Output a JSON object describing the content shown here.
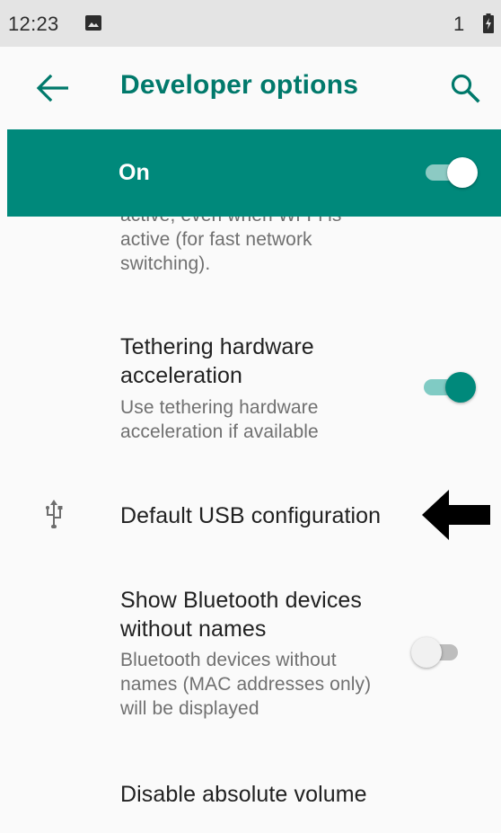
{
  "status_bar": {
    "time": "12:23",
    "sim_indicator": "1",
    "icons": [
      "image-icon",
      "battery-icon"
    ]
  },
  "app_bar": {
    "title": "Developer options",
    "back_icon": "arrow-back-icon",
    "search_icon": "search-icon"
  },
  "master_switch": {
    "label": "On",
    "checked": true
  },
  "settings": {
    "partial_item": {
      "summary": "active, even when Wi-Fi is active (for fast network switching)."
    },
    "tethering": {
      "title": "Tethering hardware acceleration",
      "summary": "Use tethering hardware acceleration if available",
      "checked": true
    },
    "usb": {
      "title": "Default USB configuration",
      "icon": "usb-icon"
    },
    "bluetooth": {
      "title": "Show Bluetooth devices without names",
      "summary": "Bluetooth devices without names (MAC addresses only) will be displayed",
      "checked": false
    },
    "absolute_volume": {
      "title": "Disable absolute volume"
    }
  },
  "colors": {
    "accent": "#00796b",
    "bar": "#00897b",
    "status_bar": "#e4e4e4",
    "background": "#fafafa"
  }
}
